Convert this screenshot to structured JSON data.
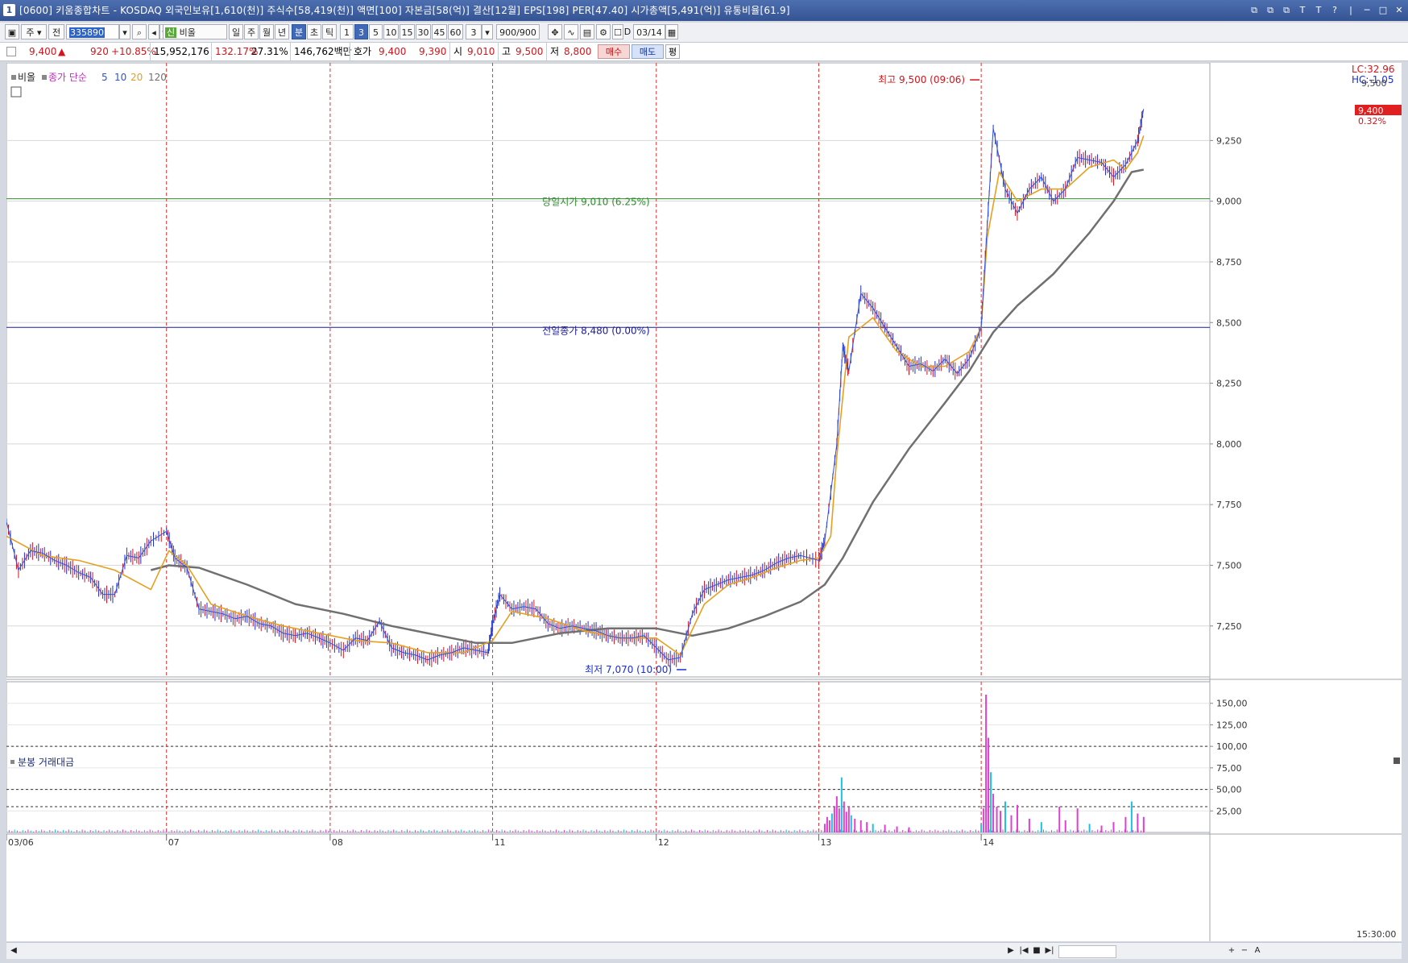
{
  "titlebar": {
    "icon": "1",
    "text": "[0600] 키움종합차트 - KOSDAQ 외국인보유[1,610(천)] 주식수[58,419(천)] 액면[100] 자본금[58(억)] 결산[12월] EPS[198] PER[47.40] 시가총액[5,491(억)] 유통비율[61.9]",
    "buttons": [
      "⧉",
      "⧉",
      "⧉",
      "T",
      "T",
      "?",
      "|",
      "─",
      "□",
      "✕"
    ]
  },
  "toolbar": {
    "period_label": "주",
    "jeon_label": "전",
    "code": "335890",
    "name": "비올",
    "name_prefix": "신",
    "tabs": [
      "일",
      "주",
      "월",
      "년",
      "분",
      "초",
      "틱"
    ],
    "selected_tab": "분",
    "intervals": [
      "1",
      "3",
      "5",
      "10",
      "15",
      "30",
      "45",
      "60"
    ],
    "selected_interval": "3",
    "interval_value": "3",
    "count": "900/900",
    "date": "03/14",
    "d_label": "D"
  },
  "quote": {
    "price": "9,400",
    "arrow": "▲",
    "change": "920",
    "change_pct": "+10.85%",
    "volume": "15,952,176",
    "vol_ratio": "132.17%",
    "turnover": "27.31%",
    "amount": "146,762백만",
    "hoga_label": "호가",
    "ask": "9,400",
    "bid": "9,390",
    "open_label": "시",
    "open": "9,010",
    "high_label": "고",
    "high": "9,500",
    "low_label": "저",
    "low": "8,800",
    "buy_label": "매수",
    "sell_label": "매도",
    "eval_label": "평"
  },
  "chart_data": {
    "type": "line",
    "price_panel": {
      "title": "비올",
      "legend_label": "종가 단순",
      "legend_periods": [
        "5",
        "10",
        "20",
        "120"
      ],
      "lc_label": "LC:32.96",
      "hc_label": "HC:-1.05",
      "ylim": [
        7040,
        9570
      ],
      "yticks": [
        7250,
        7500,
        7750,
        8000,
        8250,
        8500,
        8750,
        9000,
        9250
      ],
      "ytick_labels": [
        "7,250",
        "7,500",
        "7,750",
        "8,000",
        "8,250",
        "8,500",
        "8,750",
        "9,000",
        "9,250"
      ],
      "top_partial_label": "9,500",
      "last_price_label": "9,400",
      "last_pct_label": "0.32%",
      "open_line": {
        "value": 9010,
        "label": "당일시가 9,010 (6.25%)"
      },
      "prev_close_line": {
        "value": 8480,
        "label": "전일종가 8,480 (0.00%)"
      },
      "high_annotation": {
        "label": "최고 9,500 (09:06)",
        "value": 9500
      },
      "low_annotation": {
        "label": "최저 7,070 (10:00)",
        "value": 7070
      },
      "days": [
        "03/06",
        "07",
        "08",
        "11",
        "12",
        "13",
        "14"
      ],
      "day_boundaries": [
        0,
        0.133,
        0.269,
        0.404,
        0.54,
        0.675,
        0.81
      ],
      "last_bar_frac": 0.945,
      "close_series": {
        "x": [
          0,
          0.01,
          0.02,
          0.03,
          0.04,
          0.05,
          0.06,
          0.07,
          0.08,
          0.09,
          0.1,
          0.11,
          0.12,
          0.133,
          0.14,
          0.15,
          0.16,
          0.17,
          0.18,
          0.19,
          0.2,
          0.21,
          0.22,
          0.23,
          0.24,
          0.25,
          0.26,
          0.269,
          0.28,
          0.29,
          0.3,
          0.31,
          0.32,
          0.33,
          0.34,
          0.35,
          0.36,
          0.37,
          0.38,
          0.39,
          0.4,
          0.404,
          0.41,
          0.42,
          0.43,
          0.44,
          0.45,
          0.46,
          0.47,
          0.48,
          0.49,
          0.5,
          0.51,
          0.52,
          0.53,
          0.54,
          0.55,
          0.56,
          0.57,
          0.58,
          0.59,
          0.6,
          0.61,
          0.62,
          0.63,
          0.64,
          0.65,
          0.66,
          0.675,
          0.68,
          0.69,
          0.695,
          0.7,
          0.71,
          0.72,
          0.73,
          0.74,
          0.75,
          0.76,
          0.77,
          0.78,
          0.79,
          0.8,
          0.81,
          0.815,
          0.82,
          0.83,
          0.84,
          0.85,
          0.86,
          0.87,
          0.88,
          0.89,
          0.9,
          0.91,
          0.92,
          0.93,
          0.94,
          0.945
        ],
        "values": [
          7680,
          7480,
          7560,
          7550,
          7520,
          7500,
          7470,
          7450,
          7380,
          7380,
          7540,
          7530,
          7600,
          7640,
          7530,
          7490,
          7320,
          7310,
          7300,
          7280,
          7290,
          7260,
          7250,
          7220,
          7210,
          7220,
          7200,
          7180,
          7150,
          7200,
          7190,
          7270,
          7160,
          7140,
          7130,
          7110,
          7130,
          7140,
          7160,
          7150,
          7140,
          7260,
          7380,
          7320,
          7330,
          7320,
          7260,
          7240,
          7250,
          7240,
          7230,
          7210,
          7200,
          7200,
          7210,
          7160,
          7110,
          7120,
          7300,
          7400,
          7420,
          7440,
          7450,
          7460,
          7480,
          7510,
          7530,
          7540,
          7520,
          7600,
          8000,
          8400,
          8300,
          8620,
          8560,
          8480,
          8400,
          8320,
          8330,
          8300,
          8350,
          8290,
          8350,
          8480,
          8900,
          9300,
          9050,
          8950,
          9050,
          9100,
          9000,
          9050,
          9180,
          9170,
          9160,
          9100,
          9150,
          9250,
          9380
        ]
      },
      "ma_short": {
        "x": [
          0,
          0.03,
          0.06,
          0.09,
          0.12,
          0.135,
          0.15,
          0.17,
          0.2,
          0.23,
          0.26,
          0.29,
          0.32,
          0.35,
          0.38,
          0.404,
          0.42,
          0.45,
          0.48,
          0.51,
          0.54,
          0.56,
          0.58,
          0.6,
          0.62,
          0.64,
          0.66,
          0.675,
          0.685,
          0.69,
          0.7,
          0.72,
          0.74,
          0.76,
          0.78,
          0.8,
          0.81,
          0.815,
          0.825,
          0.84,
          0.86,
          0.88,
          0.9,
          0.92,
          0.93,
          0.94,
          0.945
        ],
        "values": [
          7620,
          7540,
          7520,
          7480,
          7400,
          7560,
          7500,
          7340,
          7290,
          7250,
          7220,
          7190,
          7180,
          7140,
          7140,
          7190,
          7310,
          7280,
          7230,
          7200,
          7200,
          7130,
          7340,
          7420,
          7450,
          7490,
          7520,
          7530,
          7620,
          7950,
          8440,
          8520,
          8380,
          8320,
          8320,
          8380,
          8480,
          8850,
          9120,
          9000,
          9050,
          9050,
          9140,
          9170,
          9130,
          9200,
          9270
        ]
      },
      "ma_long": {
        "x": [
          0.12,
          0.135,
          0.16,
          0.2,
          0.24,
          0.28,
          0.32,
          0.36,
          0.39,
          0.42,
          0.46,
          0.5,
          0.54,
          0.57,
          0.6,
          0.63,
          0.66,
          0.68,
          0.695,
          0.72,
          0.75,
          0.78,
          0.8,
          0.81,
          0.82,
          0.84,
          0.87,
          0.9,
          0.92,
          0.935,
          0.945
        ],
        "values": [
          7480,
          7500,
          7490,
          7420,
          7340,
          7300,
          7250,
          7210,
          7180,
          7180,
          7220,
          7240,
          7240,
          7210,
          7240,
          7290,
          7350,
          7420,
          7530,
          7760,
          7980,
          8170,
          8300,
          8380,
          8460,
          8570,
          8700,
          8870,
          9000,
          9120,
          9130
        ]
      }
    },
    "volume_panel": {
      "title": "분봉 거래대금",
      "ylim": [
        0,
        175
      ],
      "yticks": [
        25,
        50,
        75,
        100,
        125,
        150
      ],
      "ytick_labels": [
        "25,00",
        "50,00",
        "75,00",
        "100,00",
        "125,00",
        "150,00"
      ],
      "dashed_lines": [
        30,
        50,
        100
      ],
      "time_label": "15:30:00",
      "spikes_x": [
        0.68,
        0.682,
        0.684,
        0.686,
        0.688,
        0.69,
        0.692,
        0.694,
        0.696,
        0.698,
        0.7,
        0.702,
        0.705,
        0.71,
        0.715,
        0.72,
        0.73,
        0.74,
        0.75,
        0.81,
        0.812,
        0.814,
        0.816,
        0.818,
        0.82,
        0.823,
        0.826,
        0.83,
        0.835,
        0.84,
        0.85,
        0.86,
        0.875,
        0.88,
        0.89,
        0.9,
        0.91,
        0.92,
        0.93,
        0.935,
        0.94,
        0.945
      ],
      "spikes_values": [
        10,
        18,
        14,
        22,
        30,
        42,
        28,
        64,
        36,
        24,
        30,
        20,
        16,
        14,
        12,
        10,
        9,
        7,
        6,
        10,
        28,
        160,
        110,
        70,
        45,
        30,
        25,
        36,
        20,
        32,
        16,
        12,
        30,
        14,
        28,
        10,
        8,
        12,
        18,
        36,
        22,
        18
      ]
    }
  },
  "scroll": {
    "controls": [
      "◀",
      "▶",
      "|◀",
      "■",
      "▶|",
      "+",
      "−",
      "A"
    ]
  },
  "colors": {
    "up": "#d4141b",
    "down": "#1a2fd4",
    "ma5": "#3050e0",
    "ma20": "#e6a020",
    "ma120": "#707070",
    "open_line": "#2e8b2e",
    "prev_close_line": "#1a1a9e",
    "day_sep": "#e03030",
    "volume_bar": "#e040d0",
    "volume_bar2": "#20c0e0"
  }
}
